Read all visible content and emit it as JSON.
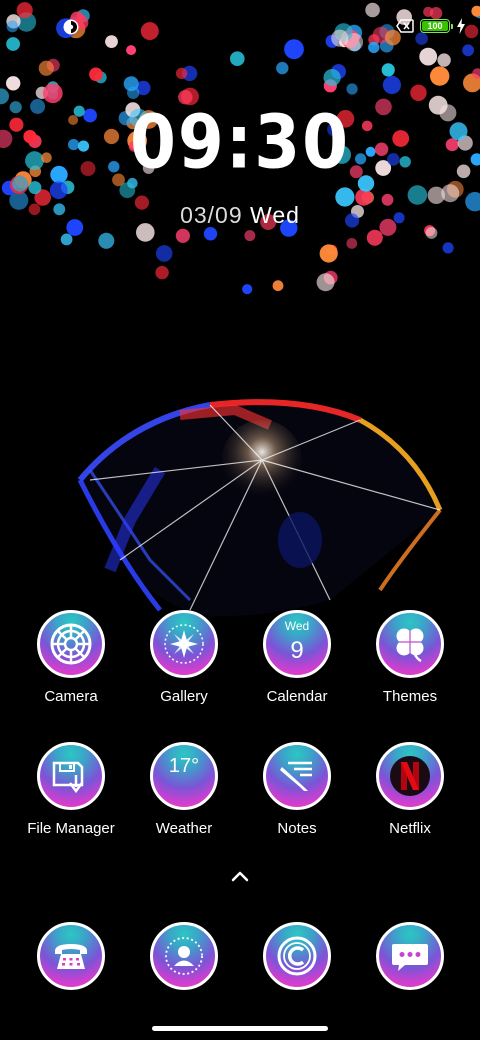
{
  "status_bar": {
    "left_icon": "assistant-dot-icon",
    "notification_icon": "notification-x-icon",
    "battery_level": "100",
    "battery_fraction": 1.0,
    "charging_icon": "lightning-bolt-icon",
    "battery_color": "#37c400"
  },
  "lockclock": {
    "time": "09:30",
    "date_numbers": "03/09",
    "date_weekday": "Wed"
  },
  "apps": [
    {
      "label": "Camera",
      "icon": "camera-icon"
    },
    {
      "label": "Gallery",
      "icon": "gallery-icon"
    },
    {
      "label": "Calendar",
      "icon": "calendar-icon",
      "badge_day": "Wed",
      "badge_date": "9"
    },
    {
      "label": "Themes",
      "icon": "clover-icon"
    },
    {
      "label": "File Manager",
      "icon": "file-manager-icon"
    },
    {
      "label": "Weather",
      "icon": "weather-icon",
      "temperature": "17°"
    },
    {
      "label": "Notes",
      "icon": "notes-icon"
    },
    {
      "label": "Netflix",
      "icon": "netflix-icon"
    }
  ],
  "dock": [
    {
      "icon": "phone-icon"
    },
    {
      "icon": "contacts-icon"
    },
    {
      "icon": "browser-icon"
    },
    {
      "icon": "messages-icon"
    }
  ],
  "theme": {
    "icon_gradient_top": "#2cc6c4",
    "icon_gradient_bottom": "#ee3fb0",
    "background": "#000000"
  }
}
